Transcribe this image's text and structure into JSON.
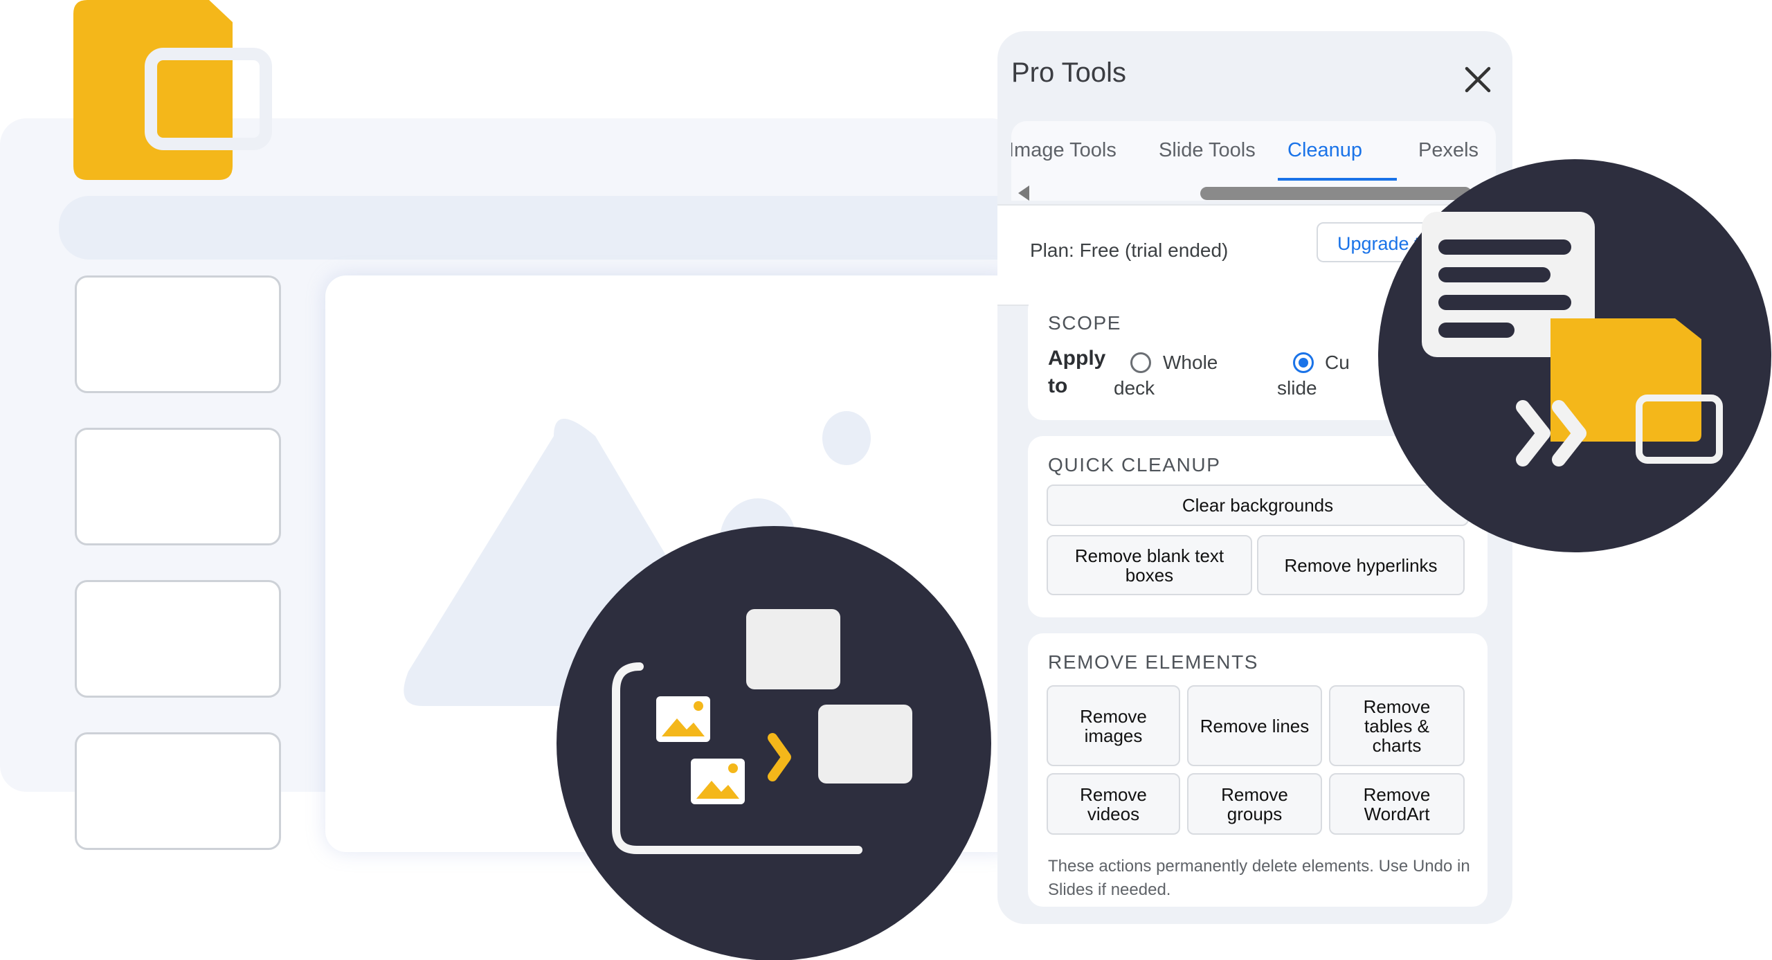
{
  "panel": {
    "title": "Pro Tools",
    "close_icon": "close-icon",
    "tabs": [
      {
        "label": "Image Tools"
      },
      {
        "label": "Slide Tools"
      },
      {
        "label": "Cleanup",
        "active": true
      },
      {
        "label": "Pexels"
      }
    ]
  },
  "plan": {
    "text": "Plan: Free (trial ended)",
    "upgrade_label": "Upgrade t"
  },
  "scope": {
    "title": "SCOPE",
    "apply_line1": "Apply",
    "apply_line2": "to",
    "options": [
      {
        "line1": "Whole",
        "line2": "deck",
        "selected": false
      },
      {
        "line1": "Cu",
        "line2": "slide",
        "selected": true
      }
    ]
  },
  "quick_cleanup": {
    "title": "QUICK CLEANUP",
    "clear_backgrounds": "Clear backgrounds",
    "remove_blank_line1": "Remove blank text",
    "remove_blank_line2": "boxes",
    "remove_hyperlinks": "Remove hyperlinks"
  },
  "remove_elements": {
    "title": "REMOVE ELEMENTS",
    "images": [
      "Remove",
      "images"
    ],
    "lines": "Remove lines",
    "tables": [
      "Remove",
      "tables &",
      "charts"
    ],
    "videos": [
      "Remove",
      "videos"
    ],
    "groups": [
      "Remove",
      "groups"
    ],
    "wordart": [
      "Remove",
      "WordArt"
    ],
    "note": "These actions permanently delete elements. Use Undo in Slides if needed."
  },
  "colors": {
    "accent": "#1a73e8",
    "brand_yellow": "#f4b71a",
    "circle_dark": "#2d2e3e"
  },
  "icons": [
    "slides-logo-icon",
    "close-icon",
    "image-placeholder-icon",
    "remove-elements-illustration-icon",
    "doc-to-slide-illustration-icon"
  ]
}
